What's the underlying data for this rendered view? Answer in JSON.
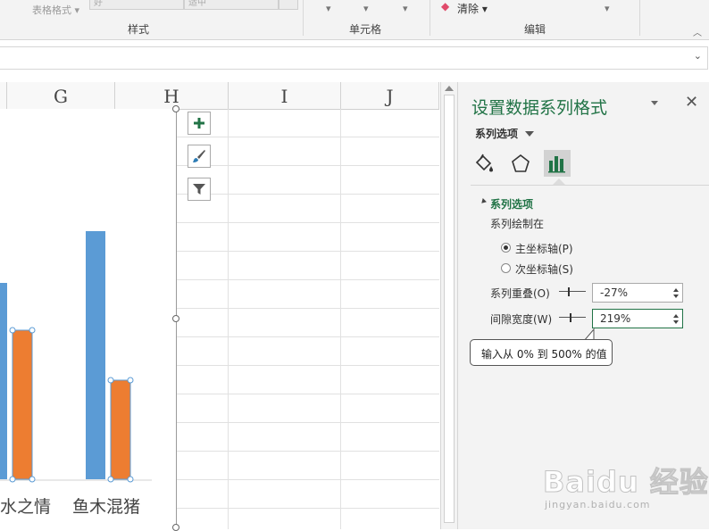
{
  "ribbon": {
    "table_format_label": "表格格式",
    "style_box_1": "好",
    "style_box_2": "适中",
    "groups": {
      "styles": "样式",
      "cells": "单元格",
      "editing": "编辑"
    },
    "clear_label": "清除"
  },
  "columns": [
    "G",
    "H",
    "I",
    "J"
  ],
  "chart": {
    "categories": [
      "水之情",
      "鱼木混猪"
    ],
    "colors": {
      "series1": "#5b9bd5",
      "series2": "#ed7d31"
    }
  },
  "chart_data": {
    "type": "bar",
    "categories": [
      "水之情",
      "鱼木混猪"
    ],
    "series": [
      {
        "values": [
          220,
          278
        ]
      },
      {
        "values": [
          167,
          111
        ]
      }
    ]
  },
  "chart_tools": [
    "plus-icon",
    "brush-icon",
    "filter-icon"
  ],
  "pane": {
    "title": "设置数据系列格式",
    "options_label": "系列选项",
    "section_title": "系列选项",
    "plot_on_label": "系列绘制在",
    "primary_axis": "主坐标轴(P)",
    "secondary_axis": "次坐标轴(S)",
    "overlap_label": "系列重叠(O)",
    "overlap_value": "-27%",
    "gap_label": "间隙宽度(W)",
    "gap_value": "219%",
    "tooltip": "输入从 0% 到 500% 的值",
    "selected_axis": "primary",
    "accent_color": "#217346",
    "overlap_slider_fraction": 0.365,
    "gap_slider_fraction": 0.438
  },
  "watermark": {
    "text": "Baidu 经验",
    "sub": "jingyan.baidu.com"
  }
}
